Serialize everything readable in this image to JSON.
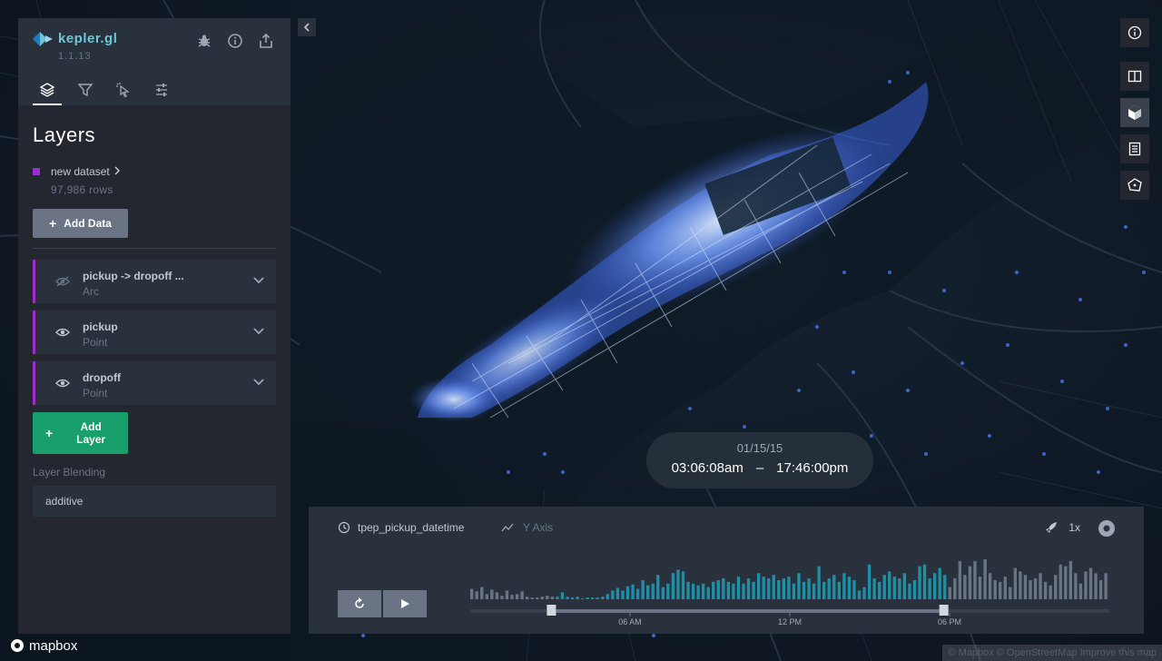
{
  "app": {
    "name": "kepler.gl",
    "version": "1.1.13"
  },
  "panel": {
    "title": "Layers",
    "tabs": [
      "layers-tab",
      "filters-tab",
      "interactions-tab",
      "map-style-tab"
    ],
    "dataset": {
      "name": "new dataset",
      "rows": "97,986 rows"
    },
    "add_data_label": "Add Data",
    "layers": [
      {
        "name": "pickup -> dropoff ...",
        "type": "Arc",
        "visible": false
      },
      {
        "name": "pickup",
        "type": "Point",
        "visible": true
      },
      {
        "name": "dropoff",
        "type": "Point",
        "visible": true
      }
    ],
    "add_layer_label": "Add Layer",
    "blending_label": "Layer Blending",
    "blending_value": "additive"
  },
  "time_display": {
    "date": "01/15/15",
    "start": "03:06:08am",
    "sep": "–",
    "end": "17:46:00pm"
  },
  "timeline": {
    "field": "tpep_pickup_datetime",
    "yaxis": "Y Axis",
    "speed": "1x",
    "ticks": [
      "06 AM",
      "12 PM",
      "06 PM"
    ],
    "histogram": [
      12,
      9,
      14,
      6,
      11,
      8,
      4,
      10,
      5,
      6,
      9,
      3,
      2,
      2,
      3,
      4,
      3,
      3,
      8,
      3,
      2,
      3,
      1,
      2,
      2,
      2,
      3,
      6,
      10,
      13,
      10,
      15,
      17,
      12,
      22,
      16,
      18,
      28,
      14,
      18,
      30,
      34,
      32,
      20,
      18,
      16,
      18,
      14,
      20,
      22,
      24,
      20,
      18,
      26,
      18,
      24,
      20,
      30,
      26,
      24,
      28,
      22,
      24,
      26,
      18,
      30,
      20,
      24,
      18,
      38,
      20,
      24,
      28,
      20,
      30,
      26,
      22,
      10,
      14,
      40,
      24,
      20,
      28,
      32,
      26,
      24,
      30,
      18,
      22,
      38,
      40,
      24,
      30,
      36,
      28,
      14,
      24,
      44,
      28,
      38,
      44,
      26,
      46,
      30,
      22,
      20,
      26,
      14,
      36,
      32,
      28,
      22,
      24,
      30,
      20,
      16,
      28,
      40,
      38,
      44,
      30,
      18,
      32,
      36,
      30,
      22,
      30
    ],
    "brush_start": 0.127,
    "brush_end": 0.741
  },
  "map_controls": [
    "info-icon",
    "split-map-icon",
    "3d-toggle-icon",
    "legend-icon",
    "draw-polygon-icon"
  ],
  "attribution": {
    "logo_text": "mapbox",
    "credits": "© Mapbox © OpenStreetMap Improve this map"
  },
  "colors": {
    "accent_purple": "#9b2fc9",
    "add_layer_green": "#189f6c",
    "histo_active": "#1f8fa6",
    "histo_inactive": "#6a7485",
    "point_blue": "#4a7dff"
  }
}
